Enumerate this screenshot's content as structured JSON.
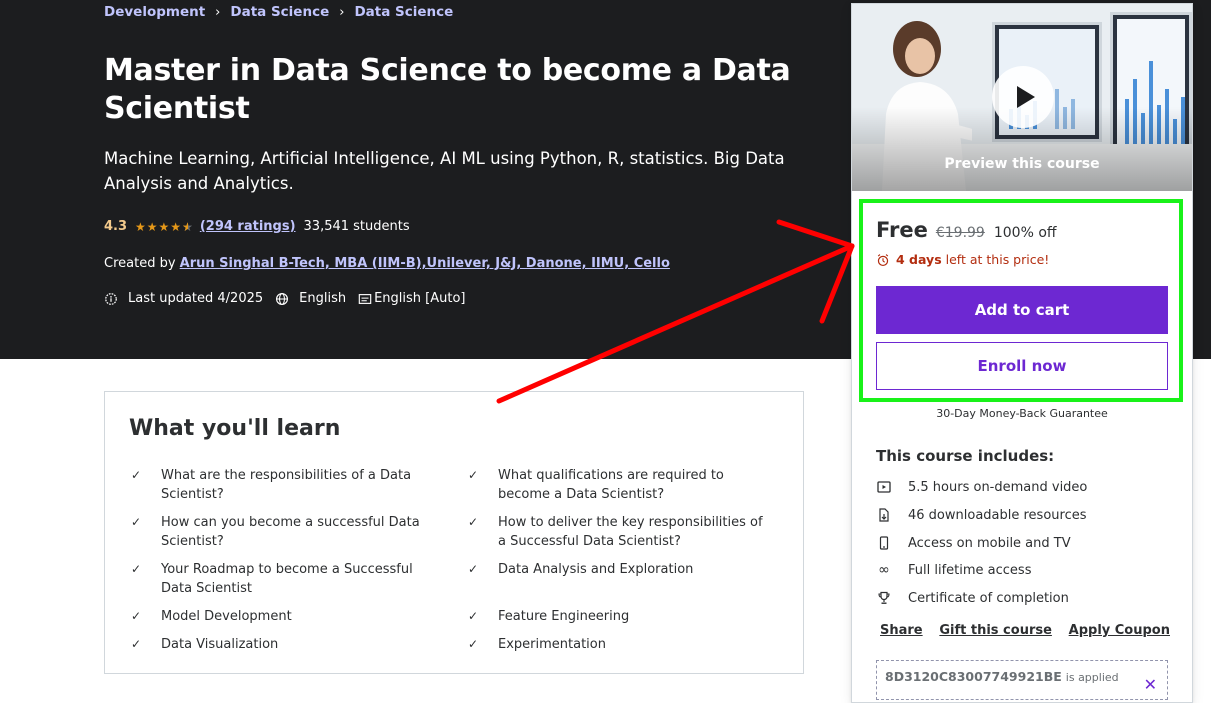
{
  "breadcrumb": [
    "Development",
    "Data Science",
    "Data Science"
  ],
  "course": {
    "title": "Master in Data Science to become a Data Scientist",
    "subtitle": "Machine Learning, Artificial Intelligence, AI ML using Python, R, statistics. Big Data Analysis and Analytics.",
    "rating": "4.3",
    "stars": 4.3,
    "ratings_link": "(294 ratings)",
    "students": "33,541 students",
    "created_by_label": "Created by",
    "instructor": "Arun Singhal B-Tech, MBA (IIM-B),Unilever, J&J, Danone, IIMU, Cello",
    "last_updated": "Last updated 4/2025",
    "language": "English",
    "captions": "English [Auto]"
  },
  "learn": {
    "heading": "What you'll learn",
    "items": [
      "What are the responsibilities of a Data Scientist?",
      "What qualifications are required to become a Data Scientist?",
      "How can you become a successful Data Scientist?",
      "How to deliver the key responsibilities of a Successful Data Scientist?",
      "Your Roadmap to become a Successful Data Scientist",
      "Data Analysis and Exploration",
      "Model Development",
      "Feature Engineering",
      "Data Visualization",
      "Experimentation"
    ]
  },
  "sidebar": {
    "preview_label": "Preview this course",
    "price": "Free",
    "original_price": "€19.99",
    "discount": "100% off",
    "timer_bold": "4 days",
    "timer_rest": "left at this price!",
    "add_to_cart": "Add to cart",
    "enroll_now": "Enroll now",
    "guarantee": "30-Day Money-Back Guarantee",
    "includes_title": "This course includes:",
    "includes": [
      {
        "icon": "video-icon",
        "text": "5.5 hours on-demand video"
      },
      {
        "icon": "download-file-icon",
        "text": "46 downloadable resources"
      },
      {
        "icon": "mobile-icon",
        "text": "Access on mobile and TV"
      },
      {
        "icon": "infinity-icon",
        "text": "Full lifetime access"
      },
      {
        "icon": "trophy-icon",
        "text": "Certificate of completion"
      }
    ],
    "share": "Share",
    "gift": "Gift this course",
    "apply_coupon": "Apply Coupon",
    "coupon_code": "8D3120C83007749921BE",
    "coupon_applied": "is applied"
  },
  "colors": {
    "hero_bg": "#1c1d1f",
    "accent_purple": "#6d28d2",
    "link_lavender": "#c0c4fc",
    "star_orange": "#e59819",
    "rating_gold": "#f3ca8c",
    "timer_red": "#b32d0f",
    "annotation_green": "#19f219",
    "annotation_arrow_red": "#ff0000"
  }
}
